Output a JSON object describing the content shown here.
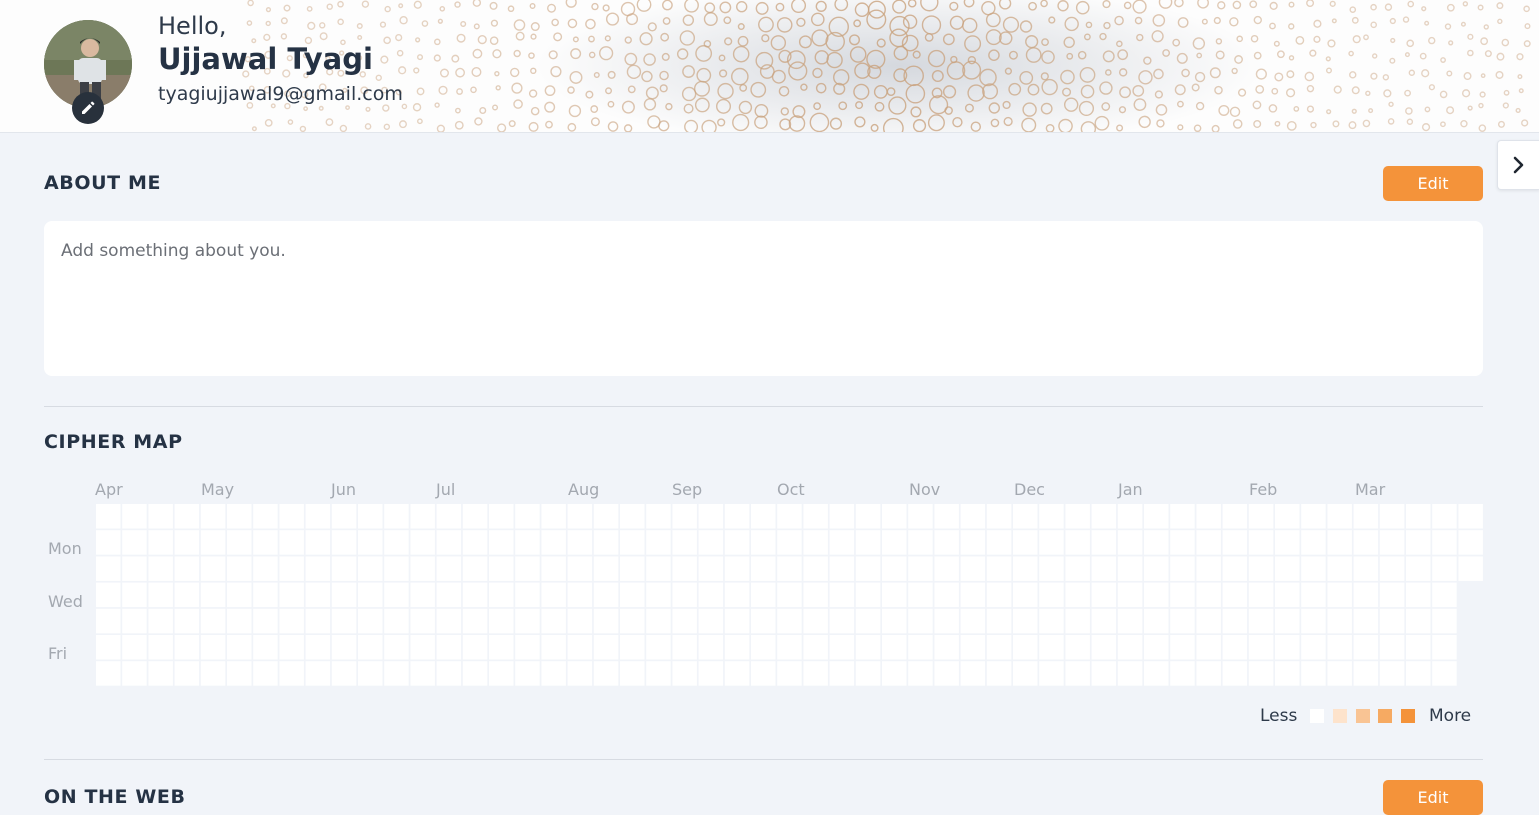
{
  "header": {
    "greeting": "Hello,",
    "name": "Ujjawal Tyagi",
    "email": "tyagiujjawal9@gmail.com"
  },
  "about": {
    "title": "ABOUT ME",
    "edit_label": "Edit",
    "placeholder": "Add something about you."
  },
  "cipher_map": {
    "title": "CIPHER MAP",
    "months": [
      "Apr",
      "May",
      "Jun",
      "Jul",
      "Aug",
      "Sep",
      "Oct",
      "Nov",
      "Dec",
      "Jan",
      "Feb",
      "Mar"
    ],
    "days": [
      "Mon",
      "Wed",
      "Fri"
    ],
    "legend": {
      "less": "Less",
      "more": "More"
    },
    "levels": [
      "#ffffff",
      "#fde3cc",
      "#f9c494",
      "#f6aa62",
      "#f4933a"
    ],
    "weeks": 53,
    "cells_last_week": 3,
    "activity": "none"
  },
  "web": {
    "title": "ON THE WEB",
    "edit_label": "Edit"
  },
  "colors": {
    "accent": "#f4933a",
    "background": "#f1f4f9",
    "heading": "#253244"
  },
  "icons": {
    "avatar_edit": "pencil-icon",
    "side_toggle": "chevron-right-icon"
  }
}
